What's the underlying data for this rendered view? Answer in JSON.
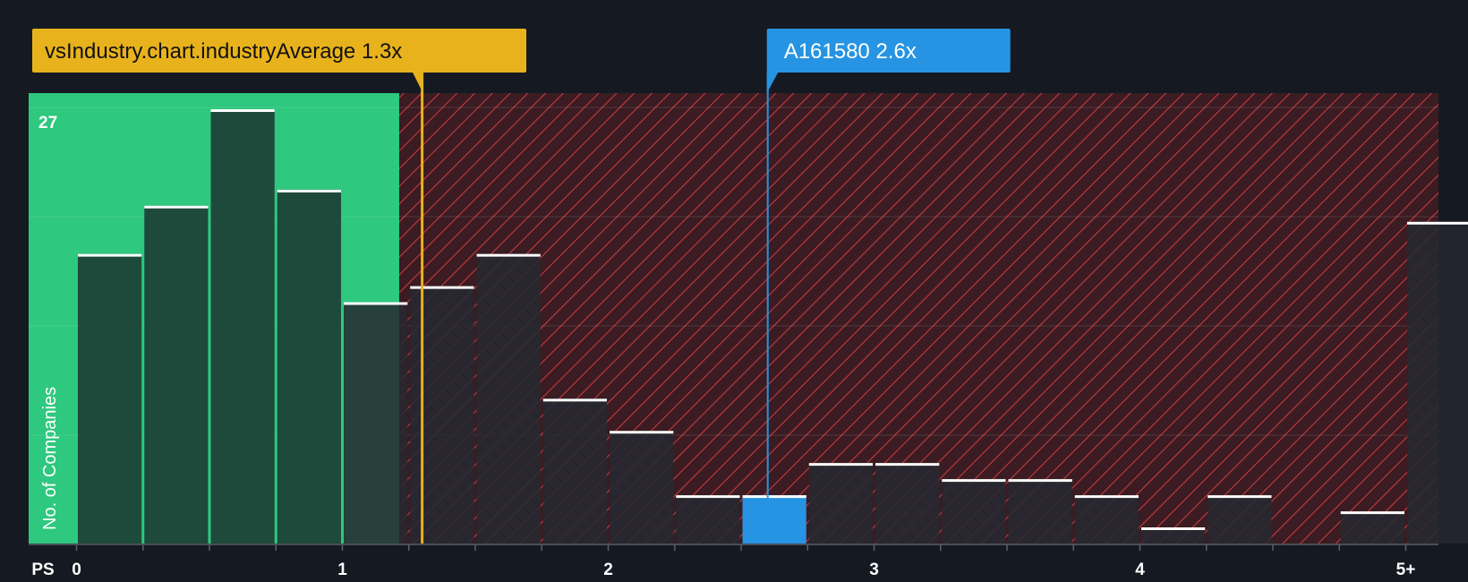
{
  "chart_data": {
    "type": "bar",
    "xlabel": "PS",
    "ylabel": "No. of Companies",
    "x_ticks": [
      "0",
      "1",
      "2",
      "3",
      "4",
      "5+"
    ],
    "y_max_label": "27",
    "ylim": [
      0,
      28
    ],
    "xlim": [
      -0.18,
      5.1
    ],
    "bin_width": 0.25,
    "bins": [
      {
        "x": 0.125,
        "value": 18
      },
      {
        "x": 0.375,
        "value": 21
      },
      {
        "x": 0.625,
        "value": 27
      },
      {
        "x": 0.875,
        "value": 22
      },
      {
        "x": 1.125,
        "value": 15
      },
      {
        "x": 1.375,
        "value": 16
      },
      {
        "x": 1.625,
        "value": 18
      },
      {
        "x": 1.875,
        "value": 9
      },
      {
        "x": 2.125,
        "value": 7
      },
      {
        "x": 2.375,
        "value": 3
      },
      {
        "x": 2.625,
        "value": 3,
        "highlight": true
      },
      {
        "x": 2.875,
        "value": 5
      },
      {
        "x": 3.125,
        "value": 5
      },
      {
        "x": 3.375,
        "value": 4
      },
      {
        "x": 3.625,
        "value": 4
      },
      {
        "x": 3.875,
        "value": 3
      },
      {
        "x": 4.125,
        "value": 1
      },
      {
        "x": 4.375,
        "value": 3
      },
      {
        "x": 4.625,
        "value": 0
      },
      {
        "x": 4.875,
        "value": 2
      },
      {
        "x": 5.125,
        "value": 20
      }
    ],
    "industry_average": {
      "label": "vsIndustry.chart.industryAverage 1.3x",
      "value": 1.3
    },
    "company": {
      "label": "A161580 2.6x",
      "value": 2.6
    },
    "grid": true,
    "colors": {
      "background": "#151a22",
      "good_zone": "#2ec87e",
      "bar_fill": "#1e4a3c",
      "bar_fill_red_zone": "#2b2d35",
      "hatch_background": "#3a1c22",
      "hatch_line": "#c9383f",
      "industry_marker": "#e8b21c",
      "company_marker": "#2694e2",
      "bar_cap": "#ffffff"
    }
  }
}
